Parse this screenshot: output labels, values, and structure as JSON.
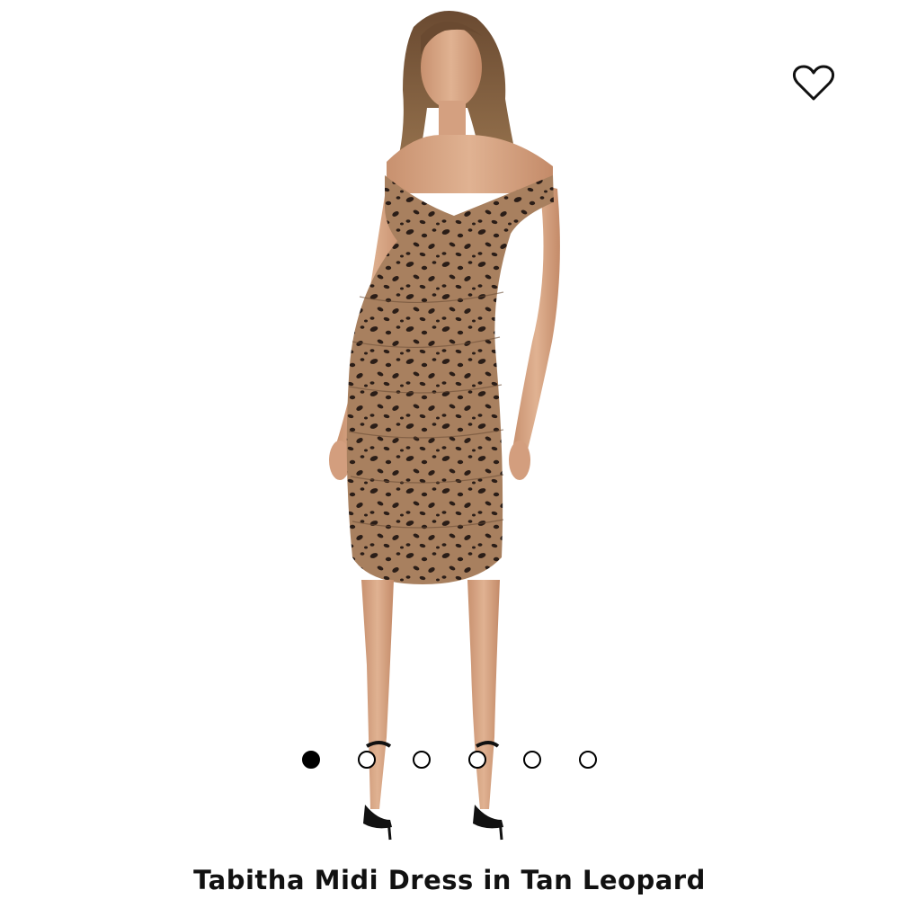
{
  "product": {
    "title": "Tabitha Midi Dress in Tan Leopard",
    "image_icon": "model-in-leopard-dress-photo"
  },
  "favorite": {
    "icon": "heart-outline-icon",
    "selected": false
  },
  "carousel": {
    "slide_count": 6,
    "active_index": 0
  },
  "colors": {
    "background": "#ffffff",
    "icon": "#111111",
    "dress_base": "#a8805f",
    "dress_spots": "#2a1d17",
    "skin": "#d9a98a",
    "hair": "#7a5535"
  }
}
